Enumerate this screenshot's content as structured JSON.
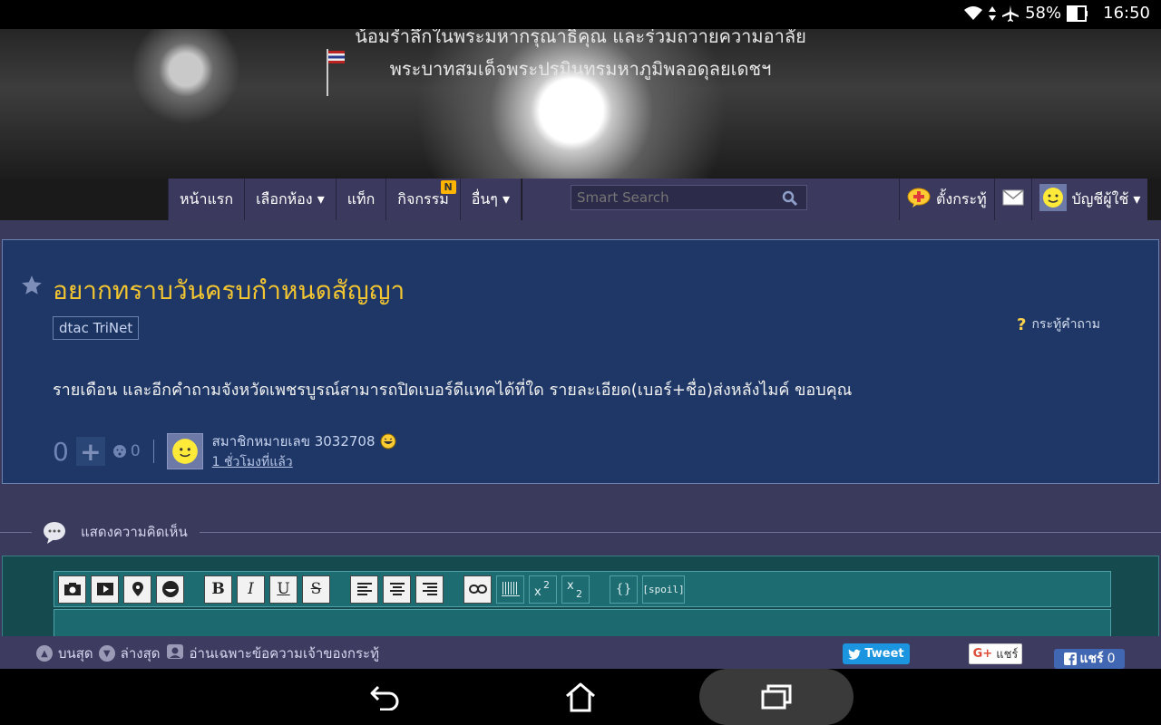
{
  "status_bar": {
    "battery": "58%",
    "time": "16:50"
  },
  "banner": {
    "line1": "น้อมรำลึกในพระมหากรุณาธิคุณ และร่วมถวายความอาลัย",
    "line2": "พระบาทสมเด็จพระปรมินทรมหาภูมิพลอดุลยเดชฯ"
  },
  "nav": {
    "items": [
      "หน้าแรก",
      "เลือกห้อง ▾",
      "แท็ก",
      "กิจกรรม",
      "อื่นๆ ▾"
    ],
    "activity_badge": "N",
    "search_placeholder": "Smart Search",
    "post_topic": "ตั้งกระทู้",
    "account": "บัญชีผู้ใช้ ▾"
  },
  "topic": {
    "title": "อยากทราบวันครบกำหนดสัญญา",
    "tag": "dtac TriNet",
    "type_label": "กระทู้คำถาม",
    "body": "รายเดือน และอีกคำถามจังหวัดเพชรบูรณ์สามารถปิดเบอร์ดีแทคได้ที่ใด รายละเอียด(เบอร์+ชื่อ)ส่งหลังไมค์ ขอบคุณ",
    "vote_count": "0",
    "emotion_count": "0",
    "author": "สมาชิกหมายเลข 3032708",
    "time_ago": "1 ชั่วโมงที่แล้ว"
  },
  "comments": {
    "label": "แสดงความคิดเห็น"
  },
  "editor": {
    "buttons": [
      "image",
      "video",
      "location",
      "emoji",
      "B",
      "I",
      "U",
      "S",
      "align-left",
      "align-center",
      "align-right",
      "link",
      "barcode",
      "superscript",
      "subscript",
      "code",
      "spoil"
    ],
    "code_label": "{}",
    "spoil_label": "[spoil]"
  },
  "bottom_bar": {
    "top": "บนสุด",
    "bottom": "ล่างสุด",
    "owner_only": "อ่านเฉพาะข้อความเจ้าของกระทู้",
    "tweet": "Tweet",
    "gplus": "แชร์",
    "fb_share": "แชร์",
    "fb_count": "0"
  },
  "colors": {
    "title": "#f3c530",
    "topic_bg": "#1e3766",
    "page_bg": "#3a3a5c",
    "editor_bg": "#154a4f"
  }
}
